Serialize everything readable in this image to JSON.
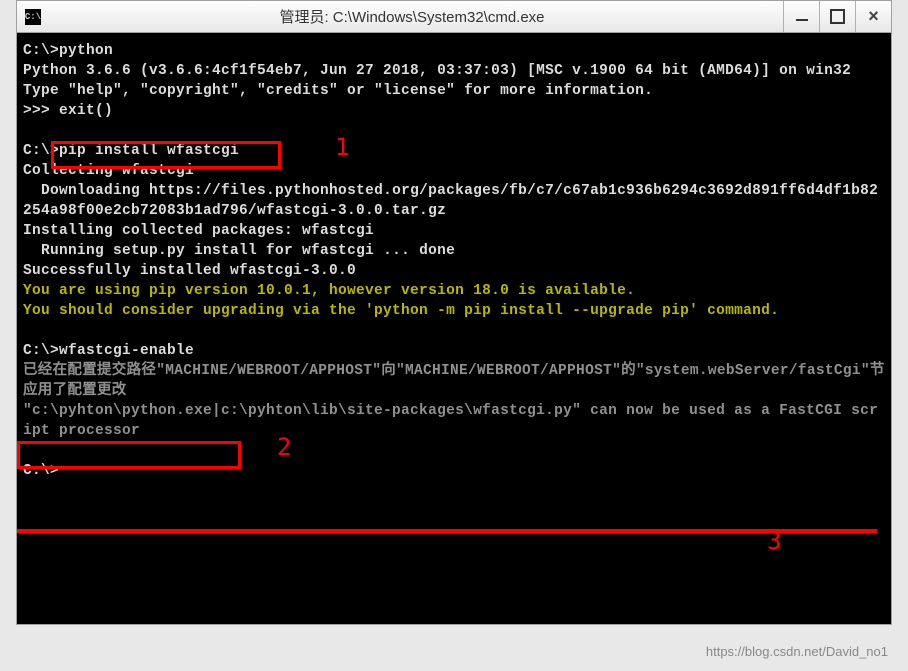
{
  "window": {
    "icon_text": "C:\\",
    "title": "管理员: C:\\Windows\\System32\\cmd.exe"
  },
  "terminal": {
    "lines": [
      {
        "text": "C:\\>python",
        "class": "term-white"
      },
      {
        "text": "Python 3.6.6 (v3.6.6:4cf1f54eb7, Jun 27 2018, 03:37:03) [MSC v.1900 64 bit (AMD64)] on win32",
        "class": "term-white"
      },
      {
        "text": "Type \"help\", \"copyright\", \"credits\" or \"license\" for more information.",
        "class": "term-white"
      },
      {
        "text": ">>> exit()",
        "class": "term-white"
      },
      {
        "text": "",
        "class": ""
      },
      {
        "text": "C:\\>pip install wfastcgi",
        "class": "term-white"
      },
      {
        "text": "Collecting wfastcgi",
        "class": "term-white"
      },
      {
        "text": "  Downloading https://files.pythonhosted.org/packages/fb/c7/c67ab1c936b6294c3692d891ff6d4df1b82254a98f00e2cb72083b1ad796/wfastcgi-3.0.0.tar.gz",
        "class": "term-white"
      },
      {
        "text": "Installing collected packages: wfastcgi",
        "class": "term-white"
      },
      {
        "text": "  Running setup.py install for wfastcgi ... done",
        "class": "term-white"
      },
      {
        "text": "Successfully installed wfastcgi-3.0.0",
        "class": "term-white"
      },
      {
        "text": "You are using pip version 10.0.1, however version 18.0 is available.",
        "class": "term-yellow"
      },
      {
        "text": "You should consider upgrading via the 'python -m pip install --upgrade pip' command.",
        "class": "term-yellow"
      },
      {
        "text": "",
        "class": ""
      },
      {
        "text": "C:\\>wfastcgi-enable",
        "class": "term-white"
      },
      {
        "text": "已经在配置提交路径\"MACHINE/WEBROOT/APPHOST\"向\"MACHINE/WEBROOT/APPHOST\"的\"system.webServer/fastCgi\"节应用了配置更改",
        "class": "term-gray"
      },
      {
        "text": "\"c:\\pyhton\\python.exe|c:\\pyhton\\lib\\site-packages\\wfastcgi.py\" can now be used as a FastCGI script processor",
        "class": "term-gray"
      },
      {
        "text": "",
        "class": ""
      },
      {
        "text": "C:\\>",
        "class": "term-white"
      }
    ]
  },
  "annotations": {
    "label1": "1",
    "label2": "2",
    "label3": "3"
  },
  "watermark": "https://blog.csdn.net/David_no1"
}
